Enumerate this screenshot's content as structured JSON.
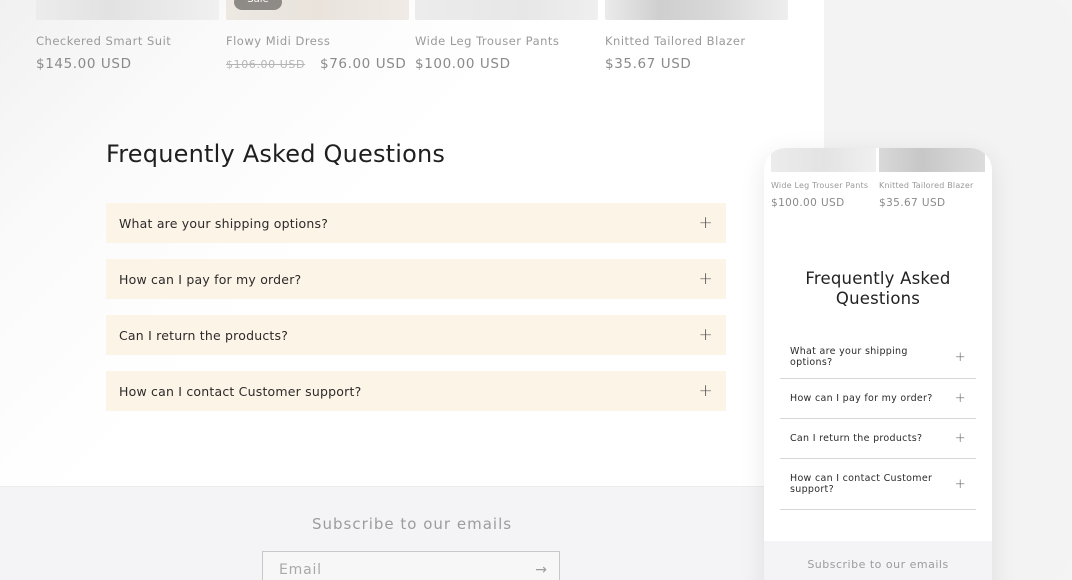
{
  "desktop": {
    "products": [
      {
        "name": "Checkered Smart Suit",
        "price": "$145.00 USD"
      },
      {
        "name": "Flowy Midi Dress",
        "badge": "Sale",
        "compare_price": "$106.00 USD",
        "price": "$76.00 USD"
      },
      {
        "name": "Wide Leg Trouser Pants",
        "price": "$100.00 USD"
      },
      {
        "name": "Knitted Tailored Blazer",
        "price": "$35.67 USD"
      }
    ],
    "faq": {
      "title": "Frequently Asked Questions",
      "items": [
        {
          "question": "What are your shipping options?",
          "icon": "plus-icon"
        },
        {
          "question": "How can I pay for my order?",
          "icon": "plus-icon"
        },
        {
          "question": "Can I return the products?",
          "icon": "plus-icon"
        },
        {
          "question": "How can I contact Customer support?",
          "icon": "plus-icon"
        }
      ]
    },
    "newsletter": {
      "title": "Subscribe to our emails",
      "email_placeholder": "Email",
      "submit_icon": "arrow-right-icon"
    }
  },
  "mobile": {
    "products": [
      {
        "name": "Wide Leg Trouser Pants",
        "price": "$100.00 USD"
      },
      {
        "name": "Knitted Tailored Blazer",
        "price": "$35.67 USD"
      }
    ],
    "faq": {
      "title_line1": "Frequently Asked",
      "title_line2": "Questions",
      "items": [
        {
          "question": "What are your shipping options?"
        },
        {
          "question": "How can I pay for my order?"
        },
        {
          "question": "Can I return the products?"
        },
        {
          "question": "How can I contact Customer support?"
        }
      ]
    },
    "newsletter": {
      "title": "Subscribe to our emails"
    }
  },
  "colors": {
    "faq_background": "#fdf4e8",
    "text_dark": "#1f1f1f",
    "text_muted": "#9a9a9a",
    "sale_badge": "#8e8a86"
  }
}
